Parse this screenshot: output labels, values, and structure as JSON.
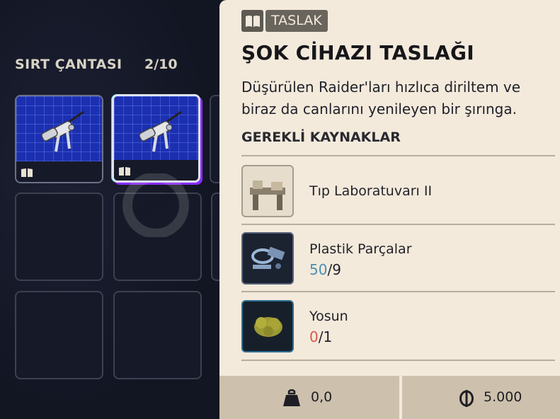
{
  "inventory": {
    "title": "SIRT ÇANTASI",
    "count": "2/10",
    "slots": [
      {
        "filled": true,
        "item_icon": "shock-device-icon",
        "badge": "book-icon"
      },
      {
        "filled": true,
        "item_icon": "shock-device-icon",
        "badge": "book-icon",
        "selected": true
      },
      {
        "filled": false
      },
      {
        "filled": false
      },
      {
        "filled": false
      },
      {
        "filled": false
      }
    ]
  },
  "detail": {
    "tag": "TASLAK",
    "tag_icon": "book-icon",
    "title": "ŞOK CİHAZI TASLAĞI",
    "description": "Düşürülen Raider'ları hızlıca diriltem ve biraz da canlarını yenileyen bir şırınga.",
    "requirements_label": "GEREKLİ KAYNAKLAR",
    "resources": [
      {
        "name": "Tıp Laboratuvarı II",
        "icon": "medical-lab-icon"
      },
      {
        "name": "Plastik Parçalar",
        "have": "50",
        "need": "/9",
        "have_color": "#4a8fb3",
        "icon": "plastic-parts-icon"
      },
      {
        "name": "Yosun",
        "have": "0",
        "need": "/1",
        "have_color": "#d9574a",
        "icon": "moss-icon"
      }
    ]
  },
  "footer": {
    "weight": "0,0",
    "weight_icon": "weight-icon",
    "price": "5.000",
    "price_icon": "coin-icon"
  }
}
